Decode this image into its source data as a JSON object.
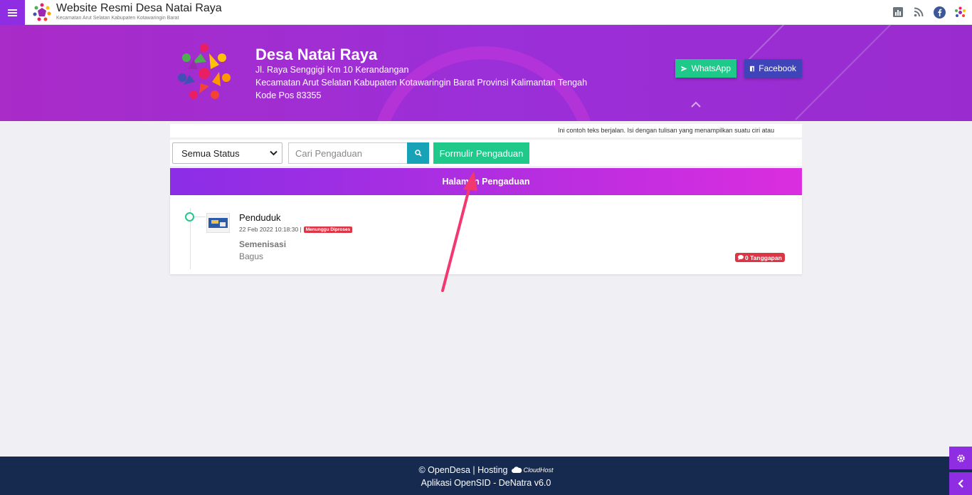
{
  "topbar": {
    "title": "Website Resmi Desa Natai Raya",
    "subtitle": "Kecamatan Arut Selatan  Kabupaten Kotawaringin Barat",
    "icons": [
      "statistics-icon",
      "rss-icon",
      "facebook-icon",
      "opensid-logo-icon"
    ]
  },
  "hero": {
    "name": "Desa Natai Raya",
    "address1": "Jl. Raya Senggigi Km 10 Kerandangan",
    "address2": "Kecamatan Arut Selatan Kabupaten Kotawaringin Barat Provinsi Kalimantan Tengah",
    "postal": "Kode Pos 83355",
    "whatsapp_label": "WhatsApp",
    "facebook_label": "Facebook"
  },
  "marquee": {
    "text": "Ini contoh teks berjalan. Isi dengan tulisan yang menampilkan suatu ciri atau"
  },
  "filters": {
    "status_selected": "Semua Status",
    "search_placeholder": "Cari Pengaduan",
    "form_button": "Formulir Pengaduan"
  },
  "panel": {
    "title": "Halaman Pengaduan",
    "items": [
      {
        "category": "Penduduk",
        "date": "22 Feb 2022 10:18:30 |",
        "status": "Menunggu Diproses",
        "subject": "Semenisasi",
        "text": "Bagus",
        "replies": "0 Tanggapan"
      }
    ]
  },
  "footer": {
    "line1_prefix": "© OpenDesa | Hosting",
    "hosting_brand": "CloudHost",
    "line2": "Aplikasi OpenSID - DeNatra v6.0"
  },
  "colors": {
    "primary": "#8e2de2",
    "accent": "#1fc98a",
    "info": "#17a2b8",
    "danger": "#dc3545",
    "footer": "#162a4f",
    "annotation": "#f2386e"
  }
}
